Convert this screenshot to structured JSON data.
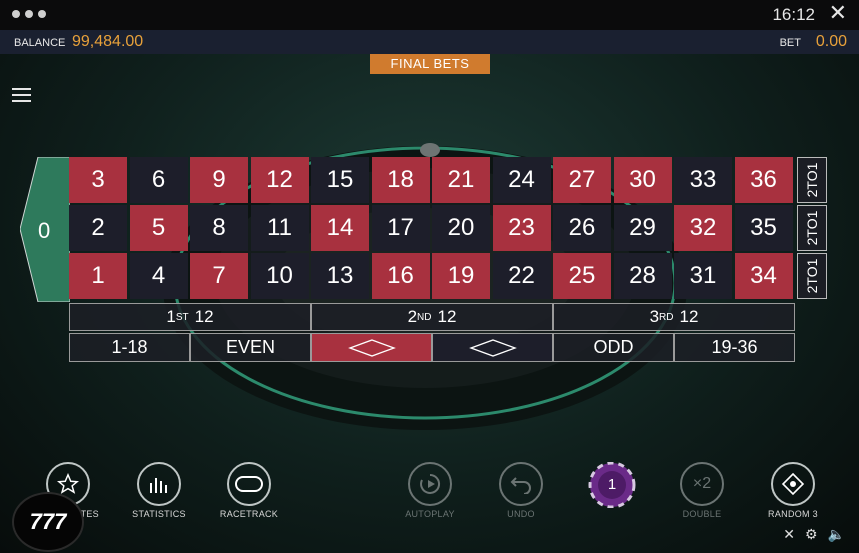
{
  "window": {
    "time": "16:12"
  },
  "header": {
    "balance_label": "BALANCE",
    "balance_value": "99,484.00",
    "bet_label": "BET",
    "bet_value": "0.00",
    "status": "FINAL BETS"
  },
  "colors": {
    "red": "#a8313f",
    "black": "#1d1e2a",
    "green": "#2e7a5c",
    "accent": "#e8a13a",
    "banner": "#d07b2e"
  },
  "board": {
    "zero": "0",
    "rows": [
      [
        {
          "n": "3",
          "c": "red"
        },
        {
          "n": "6",
          "c": "black"
        },
        {
          "n": "9",
          "c": "red"
        },
        {
          "n": "12",
          "c": "red"
        },
        {
          "n": "15",
          "c": "black"
        },
        {
          "n": "18",
          "c": "red"
        },
        {
          "n": "21",
          "c": "red"
        },
        {
          "n": "24",
          "c": "black"
        },
        {
          "n": "27",
          "c": "red"
        },
        {
          "n": "30",
          "c": "red"
        },
        {
          "n": "33",
          "c": "black"
        },
        {
          "n": "36",
          "c": "red"
        }
      ],
      [
        {
          "n": "2",
          "c": "black"
        },
        {
          "n": "5",
          "c": "red"
        },
        {
          "n": "8",
          "c": "black"
        },
        {
          "n": "11",
          "c": "black"
        },
        {
          "n": "14",
          "c": "red"
        },
        {
          "n": "17",
          "c": "black"
        },
        {
          "n": "20",
          "c": "black"
        },
        {
          "n": "23",
          "c": "red"
        },
        {
          "n": "26",
          "c": "black"
        },
        {
          "n": "29",
          "c": "black"
        },
        {
          "n": "32",
          "c": "red"
        },
        {
          "n": "35",
          "c": "black"
        }
      ],
      [
        {
          "n": "1",
          "c": "red"
        },
        {
          "n": "4",
          "c": "black"
        },
        {
          "n": "7",
          "c": "red"
        },
        {
          "n": "10",
          "c": "black"
        },
        {
          "n": "13",
          "c": "black"
        },
        {
          "n": "16",
          "c": "red"
        },
        {
          "n": "19",
          "c": "red"
        },
        {
          "n": "22",
          "c": "black"
        },
        {
          "n": "25",
          "c": "red"
        },
        {
          "n": "28",
          "c": "black"
        },
        {
          "n": "31",
          "c": "black"
        },
        {
          "n": "34",
          "c": "red"
        }
      ]
    ],
    "column_bet": "2TO1",
    "dozens": [
      {
        "num": "1",
        "sup": "ST",
        "label": "12"
      },
      {
        "num": "2",
        "sup": "ND",
        "label": "12"
      },
      {
        "num": "3",
        "sup": "RD",
        "label": "12"
      }
    ],
    "outside": {
      "low": "1-18",
      "even": "EVEN",
      "odd": "ODD",
      "high": "19-36"
    }
  },
  "controls": {
    "favourites": "FAVOURITES",
    "favourites_visible": "RITES",
    "statistics": "STATISTICS",
    "racetrack": "RACETRACK",
    "autoplay": "AUTOPLAY",
    "undo": "UNDO",
    "chip_value": "1",
    "double": "DOUBLE",
    "double_glyph": "×2",
    "random": "RANDOM 3"
  },
  "logo": "777"
}
